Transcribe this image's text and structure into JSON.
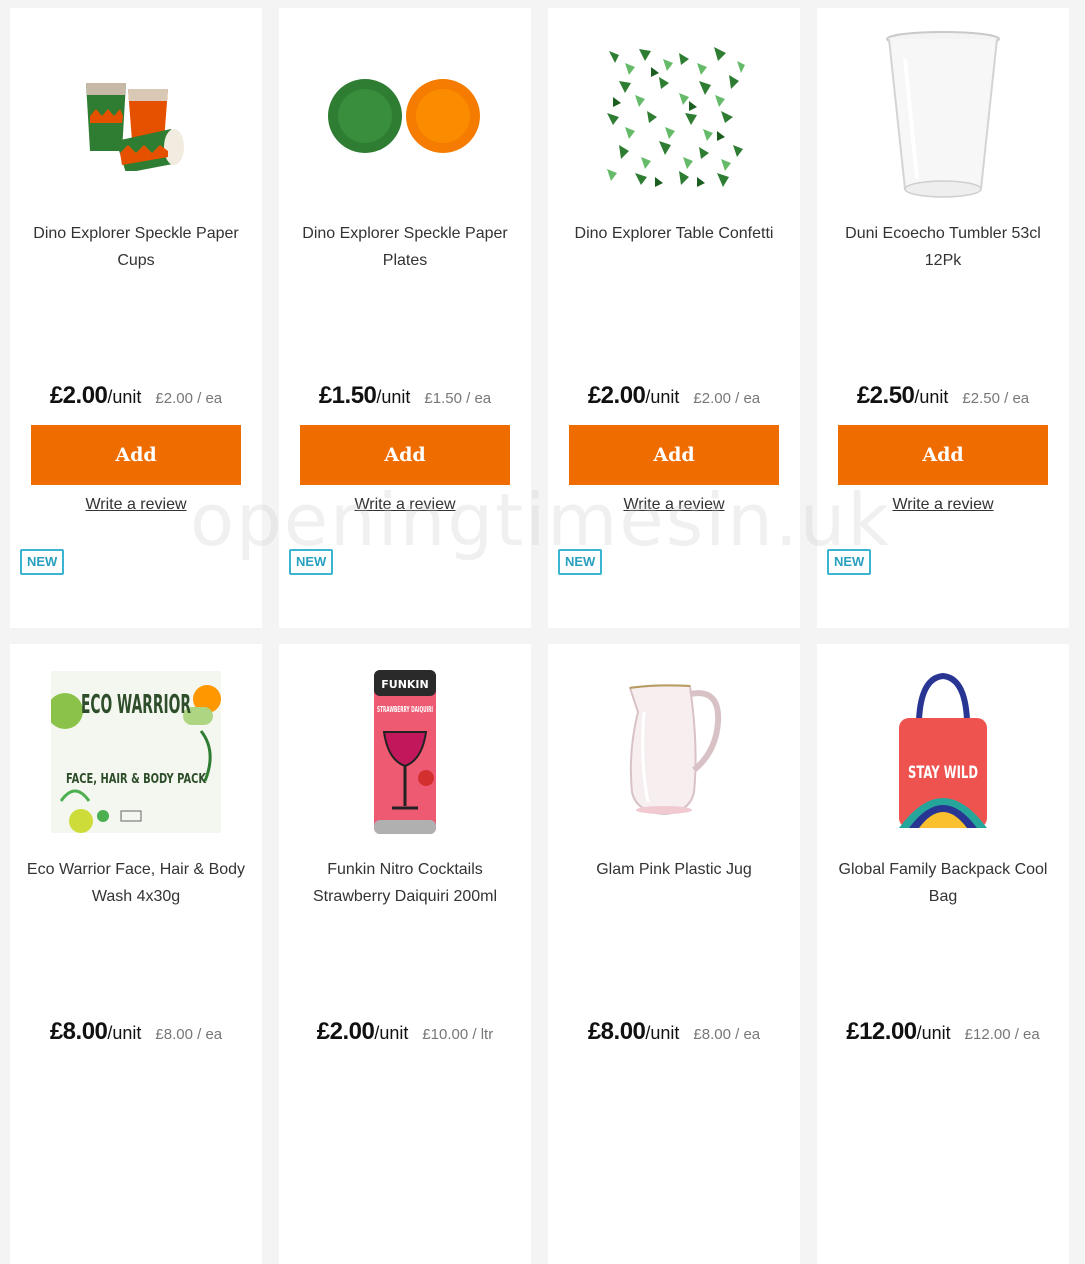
{
  "products": [
    {
      "title": "Dino Explorer Speckle Paper Cups",
      "price": "£2.00",
      "per": "/unit",
      "unit_price": "£2.00 / ea",
      "add_label": "Add",
      "review_label": "Write a review",
      "badge": "NEW",
      "image": "paper-cups-image"
    },
    {
      "title": "Dino Explorer Speckle Paper Plates",
      "price": "£1.50",
      "per": "/unit",
      "unit_price": "£1.50 / ea",
      "add_label": "Add",
      "review_label": "Write a review",
      "badge": "NEW",
      "image": "paper-plates-image"
    },
    {
      "title": "Dino Explorer Table Confetti",
      "price": "£2.00",
      "per": "/unit",
      "unit_price": "£2.00 / ea",
      "add_label": "Add",
      "review_label": "Write a review",
      "badge": "NEW",
      "image": "table-confetti-image"
    },
    {
      "title": "Duni Ecoecho Tumbler 53cl 12Pk",
      "price": "£2.50",
      "per": "/unit",
      "unit_price": "£2.50 / ea",
      "add_label": "Add",
      "review_label": "Write a review",
      "badge": "NEW",
      "image": "plastic-tumbler-image"
    },
    {
      "title": "Eco Warrior Face, Hair & Body Wash 4x30g",
      "price": "£8.00",
      "per": "/unit",
      "unit_price": "£8.00 / ea",
      "image": "eco-warrior-pack-image"
    },
    {
      "title": "Funkin Nitro Cocktails Strawberry Daiquiri 200ml",
      "price": "£2.00",
      "per": "/unit",
      "unit_price": "£10.00 / ltr",
      "image": "cocktail-can-image"
    },
    {
      "title": "Glam Pink Plastic Jug",
      "price": "£8.00",
      "per": "/unit",
      "unit_price": "£8.00 / ea",
      "image": "plastic-jug-image"
    },
    {
      "title": "Global Family Backpack Cool Bag",
      "price": "£12.00",
      "per": "/unit",
      "unit_price": "£12.00 / ea",
      "image": "cool-bag-image"
    }
  ],
  "image_text": {
    "eco_brand": "ECO WARRIOR",
    "eco_line": "FACE, HAIR & BODY PACK",
    "can_brand": "FUNKIN",
    "can_flavour": "STRAWBERRY DAIQUIRI",
    "bag_text": "STAY WILD"
  },
  "watermark": "openingtimesin.uk",
  "colors": {
    "accent": "#ef6c00",
    "badge": "#3bb4d1",
    "background": "#f4f4f4"
  }
}
